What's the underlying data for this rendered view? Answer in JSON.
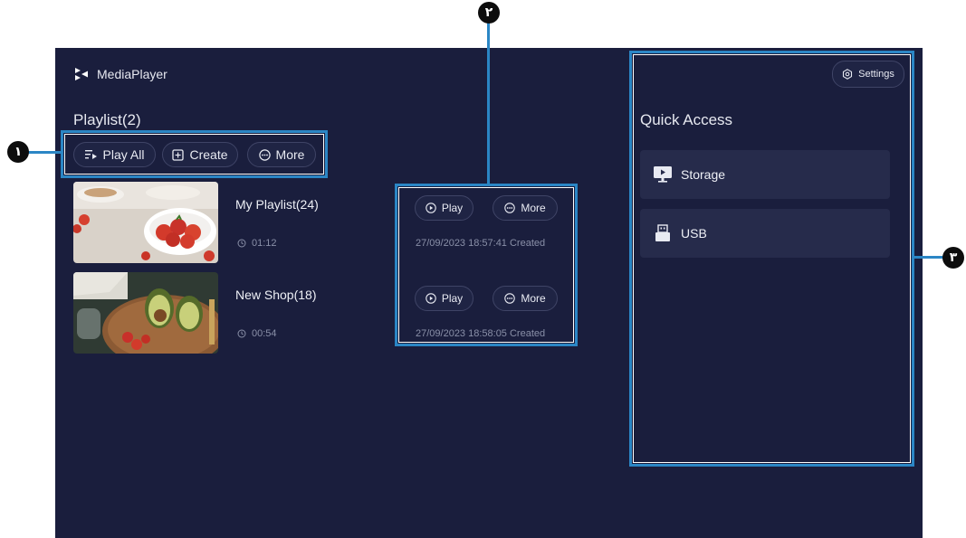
{
  "app": {
    "title": "MediaPlayer"
  },
  "playlist": {
    "heading": "Playlist(2)",
    "actions": {
      "play_all": "Play All",
      "create": "Create",
      "more": "More"
    },
    "items": [
      {
        "name": "My Playlist(24)",
        "duration": "01:12",
        "created": "27/09/2023 18:57:41 Created",
        "play_label": "Play",
        "more_label": "More"
      },
      {
        "name": "New Shop(18)",
        "duration": "00:54",
        "created": "27/09/2023 18:58:05 Created",
        "play_label": "Play",
        "more_label": "More"
      }
    ]
  },
  "sidebar": {
    "settings_label": "Settings",
    "heading": "Quick Access",
    "items": [
      {
        "label": "Storage",
        "icon": "storage-icon"
      },
      {
        "label": "USB",
        "icon": "usb-icon"
      }
    ]
  },
  "callouts": {
    "one": "١",
    "two": "٢",
    "three": "٣"
  },
  "colors": {
    "background": "#1a1e3d",
    "card": "#262b4b",
    "callout": "#2b86c5",
    "muted_text": "#8a90a8"
  }
}
